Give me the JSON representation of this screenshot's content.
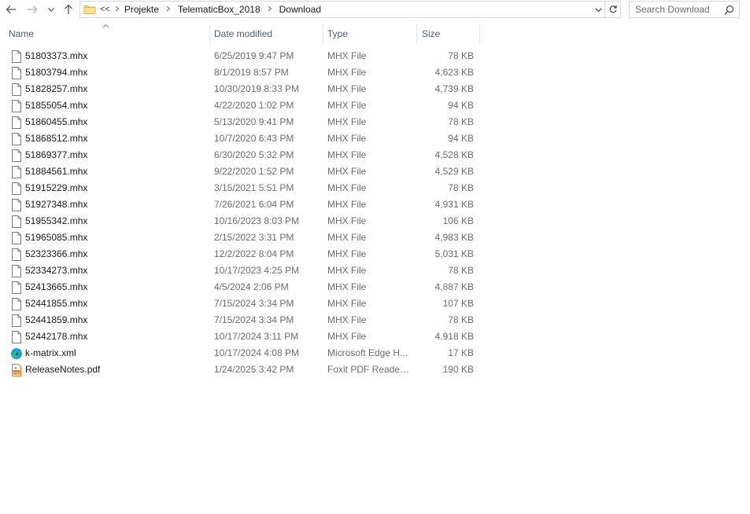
{
  "address": {
    "overflow_label": "<<",
    "crumbs": [
      "Projekte",
      "TelematicBox_2018",
      "Download"
    ]
  },
  "search": {
    "placeholder": "Search Download"
  },
  "columns": {
    "name": "Name",
    "date": "Date modified",
    "type": "Type",
    "size": "Size"
  },
  "files": [
    {
      "name": "51803373.mhx",
      "date": "6/25/2019 9:47 PM",
      "type": "MHX File",
      "size": "78 KB",
      "icon": "document-icon"
    },
    {
      "name": "51803794.mhx",
      "date": "8/1/2019 8:57 PM",
      "type": "MHX File",
      "size": "4,623 KB",
      "icon": "document-icon"
    },
    {
      "name": "51828257.mhx",
      "date": "10/30/2019 8:33 PM",
      "type": "MHX File",
      "size": "4,739 KB",
      "icon": "document-icon"
    },
    {
      "name": "51855054.mhx",
      "date": "4/22/2020 1:02 PM",
      "type": "MHX File",
      "size": "94 KB",
      "icon": "document-icon"
    },
    {
      "name": "51860455.mhx",
      "date": "5/13/2020 9:41 PM",
      "type": "MHX File",
      "size": "78 KB",
      "icon": "document-icon"
    },
    {
      "name": "51868512.mhx",
      "date": "10/7/2020 6:43 PM",
      "type": "MHX File",
      "size": "94 KB",
      "icon": "document-icon"
    },
    {
      "name": "51869377.mhx",
      "date": "6/30/2020 5:32 PM",
      "type": "MHX File",
      "size": "4,528 KB",
      "icon": "document-icon"
    },
    {
      "name": "51884561.mhx",
      "date": "9/22/2020 1:52 PM",
      "type": "MHX File",
      "size": "4,529 KB",
      "icon": "document-icon"
    },
    {
      "name": "51915229.mhx",
      "date": "3/15/2021 5:51 PM",
      "type": "MHX File",
      "size": "78 KB",
      "icon": "document-icon"
    },
    {
      "name": "51927348.mhx",
      "date": "7/26/2021 6:04 PM",
      "type": "MHX File",
      "size": "4,931 KB",
      "icon": "document-icon"
    },
    {
      "name": "51955342.mhx",
      "date": "10/16/2023 8:03 PM",
      "type": "MHX File",
      "size": "106 KB",
      "icon": "document-icon"
    },
    {
      "name": "51965085.mhx",
      "date": "2/15/2022 3:31 PM",
      "type": "MHX File",
      "size": "4,983 KB",
      "icon": "document-icon"
    },
    {
      "name": "52323366.mhx",
      "date": "12/2/2022 8:04 PM",
      "type": "MHX File",
      "size": "5,031 KB",
      "icon": "document-icon"
    },
    {
      "name": "52334273.mhx",
      "date": "10/17/2023 4:25 PM",
      "type": "MHX File",
      "size": "78 KB",
      "icon": "document-icon"
    },
    {
      "name": "52413665.mhx",
      "date": "4/5/2024 2:06 PM",
      "type": "MHX File",
      "size": "4,887 KB",
      "icon": "document-icon"
    },
    {
      "name": "52441855.mhx",
      "date": "7/15/2024 3:34 PM",
      "type": "MHX File",
      "size": "107 KB",
      "icon": "document-icon"
    },
    {
      "name": "52441859.mhx",
      "date": "7/15/2024 3:34 PM",
      "type": "MHX File",
      "size": "78 KB",
      "icon": "document-icon"
    },
    {
      "name": "52442178.mhx",
      "date": "10/17/2024 3:11 PM",
      "type": "MHX File",
      "size": "4,918 KB",
      "icon": "document-icon"
    },
    {
      "name": "k-matrix.xml",
      "date": "10/17/2024 4:08 PM",
      "type": "Microsoft Edge H...",
      "size": "17 KB",
      "icon": "edge-icon"
    },
    {
      "name": "ReleaseNotes.pdf",
      "date": "1/24/2025 3:42 PM",
      "type": "Foxit PDF Reader ...",
      "size": "190 KB",
      "icon": "pdf-icon"
    }
  ]
}
